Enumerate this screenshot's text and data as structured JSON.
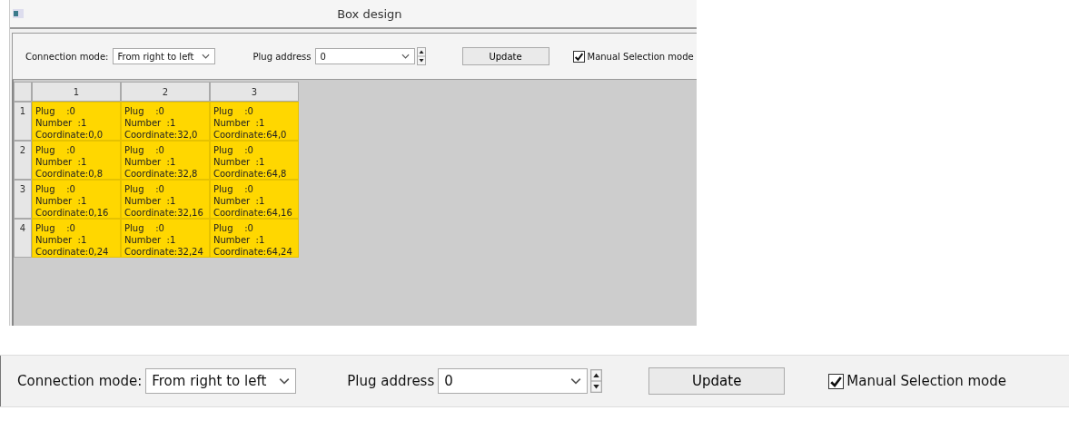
{
  "window": {
    "title": "Box design"
  },
  "toolbar": {
    "connection_label": "Connection mode:",
    "connection_value": "From right to left",
    "plug_label": "Plug address",
    "plug_value": "0",
    "update_button": "Update",
    "manual_checkbox": {
      "label": "Manual Selection mode",
      "checked": true
    }
  },
  "table": {
    "columns": [
      "1",
      "2",
      "3"
    ],
    "rows": [
      {
        "header": "1",
        "cells": [
          {
            "lines": [
              "Plug    :0",
              "Number  :1",
              "Coordinate:0,0"
            ]
          },
          {
            "lines": [
              "Plug    :0",
              "Number  :1",
              "Coordinate:32,0"
            ]
          },
          {
            "lines": [
              "Plug    :0",
              "Number  :1",
              "Coordinate:64,0"
            ]
          }
        ]
      },
      {
        "header": "2",
        "cells": [
          {
            "lines": [
              "Plug    :0",
              "Number  :1",
              "Coordinate:0,8"
            ]
          },
          {
            "lines": [
              "Plug    :0",
              "Number  :1",
              "Coordinate:32,8"
            ]
          },
          {
            "lines": [
              "Plug    :0",
              "Number  :1",
              "Coordinate:64,8"
            ]
          }
        ]
      },
      {
        "header": "3",
        "cells": [
          {
            "lines": [
              "Plug    :0",
              "Number  :1",
              "Coordinate:0,16"
            ]
          },
          {
            "lines": [
              "Plug    :0",
              "Number  :1",
              "Coordinate:32,16"
            ]
          },
          {
            "lines": [
              "Plug    :0",
              "Number  :1",
              "Coordinate:64,16"
            ]
          }
        ]
      },
      {
        "header": "4",
        "cells": [
          {
            "lines": [
              "Plug    :0",
              "Number  :1",
              "Coordinate:0,24"
            ]
          },
          {
            "lines": [
              "Plug    :0",
              "Number  :1",
              "Coordinate:32,24"
            ]
          },
          {
            "lines": [
              "Plug    :0",
              "Number  :1",
              "Coordinate:64,24"
            ]
          }
        ]
      }
    ]
  },
  "zoomed_toolbar": {
    "connection_label": "Connection mode:",
    "connection_value": "From right to left",
    "plug_label": "Plug address",
    "plug_value": "0",
    "update_button": "Update",
    "manual_checkbox": {
      "label": "Manual Selection mode",
      "checked": true
    }
  }
}
